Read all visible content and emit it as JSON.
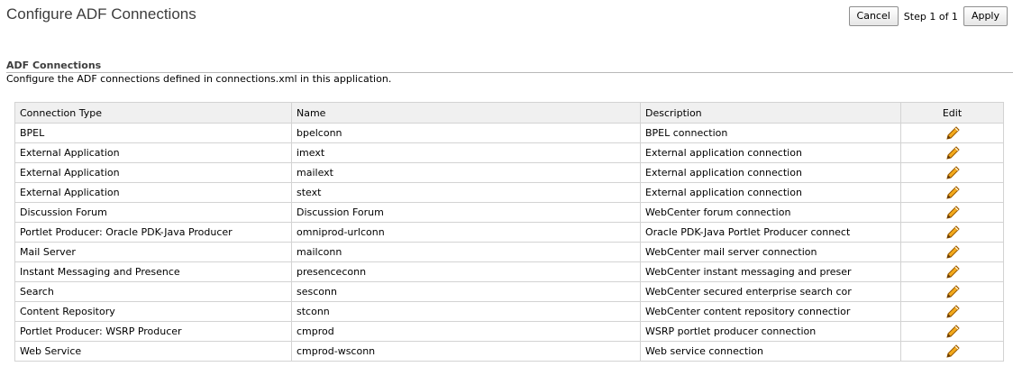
{
  "page": {
    "title": "Configure ADF Connections"
  },
  "train": {
    "cancel_label": "Cancel",
    "step_text": "Step 1 of 1",
    "apply_label": "Apply"
  },
  "section": {
    "header": "ADF Connections",
    "description": "Configure the ADF connections defined in connections.xml in this application."
  },
  "table": {
    "columns": [
      "Connection Type",
      "Name",
      "Description",
      "Edit"
    ],
    "rows": [
      {
        "type": "BPEL",
        "name": "bpelconn",
        "description": "BPEL connection"
      },
      {
        "type": "External Application",
        "name": "imext",
        "description": "External application connection"
      },
      {
        "type": "External Application",
        "name": "mailext",
        "description": "External application connection"
      },
      {
        "type": "External Application",
        "name": "stext",
        "description": "External application connection"
      },
      {
        "type": "Discussion Forum",
        "name": "Discussion Forum",
        "description": "WebCenter forum connection"
      },
      {
        "type": "Portlet Producer: Oracle PDK-Java Producer",
        "name": "omniprod-urlconn",
        "description": "Oracle PDK-Java Portlet Producer connect"
      },
      {
        "type": "Mail Server",
        "name": "mailconn",
        "description": "WebCenter mail server connection"
      },
      {
        "type": "Instant Messaging and Presence",
        "name": "presenceconn",
        "description": "WebCenter instant messaging and preser"
      },
      {
        "type": "Search",
        "name": "sesconn",
        "description": "WebCenter secured enterprise search cor"
      },
      {
        "type": "Content Repository",
        "name": "stconn",
        "description": "WebCenter content repository connectior"
      },
      {
        "type": "Portlet Producer: WSRP Producer",
        "name": "cmprod",
        "description": "WSRP portlet producer connection"
      },
      {
        "type": "Web Service",
        "name": "cmprod-wsconn",
        "description": "Web service connection"
      }
    ]
  },
  "icons": {
    "edit": "pencil-icon"
  },
  "colors": {
    "title": "#3d3d3d",
    "header_bg": "#f0f0f0",
    "border": "#d3d3d3",
    "pencil": "#e8a000"
  }
}
